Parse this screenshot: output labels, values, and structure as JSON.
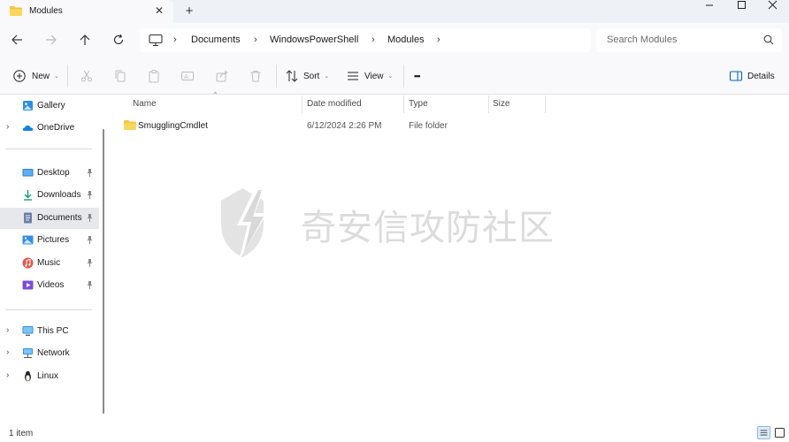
{
  "window": {
    "tab_title": "Modules",
    "close_tab_glyph": "✕",
    "new_tab_glyph": "+"
  },
  "address": {
    "breadcrumbs": [
      "Documents",
      "WindowsPowerShell",
      "Modules"
    ],
    "separator": "›",
    "search_placeholder": "Search Modules"
  },
  "toolbar": {
    "new_label": "New",
    "sort_label": "Sort",
    "view_label": "View",
    "more_glyph": "•••",
    "details_label": "Details"
  },
  "sidebar": {
    "items": [
      {
        "label": "Gallery",
        "icon": "gallery-icon",
        "expandable": false,
        "pinned": false
      },
      {
        "label": "OneDrive",
        "icon": "onedrive-icon",
        "expandable": true,
        "pinned": false
      },
      {
        "label": "Desktop",
        "icon": "desktop-icon",
        "expandable": false,
        "pinned": true
      },
      {
        "label": "Downloads",
        "icon": "downloads-icon",
        "expandable": false,
        "pinned": true
      },
      {
        "label": "Documents",
        "icon": "documents-icon",
        "expandable": false,
        "pinned": true,
        "selected": true
      },
      {
        "label": "Pictures",
        "icon": "pictures-icon",
        "expandable": false,
        "pinned": true
      },
      {
        "label": "Music",
        "icon": "music-icon",
        "expandable": false,
        "pinned": true
      },
      {
        "label": "Videos",
        "icon": "videos-icon",
        "expandable": false,
        "pinned": true
      },
      {
        "label": "This PC",
        "icon": "this-pc-icon",
        "expandable": true,
        "pinned": false
      },
      {
        "label": "Network",
        "icon": "network-icon",
        "expandable": true,
        "pinned": false
      },
      {
        "label": "Linux",
        "icon": "linux-icon",
        "expandable": true,
        "pinned": false
      }
    ]
  },
  "columns": {
    "name": "Name",
    "date_modified": "Date modified",
    "type": "Type",
    "size": "Size"
  },
  "files": [
    {
      "name": "SmugglingCmdlet",
      "date_modified": "6/12/2024 2:26 PM",
      "type": "File folder",
      "size": ""
    }
  ],
  "watermark": {
    "text": "奇安信攻防社区"
  },
  "status": {
    "item_count": "1 item"
  },
  "colors": {
    "accent": "#0067c0",
    "folder": "#f4c443",
    "selected_bg": "#e6e8ec",
    "chrome_bg": "#f9f9fb"
  }
}
